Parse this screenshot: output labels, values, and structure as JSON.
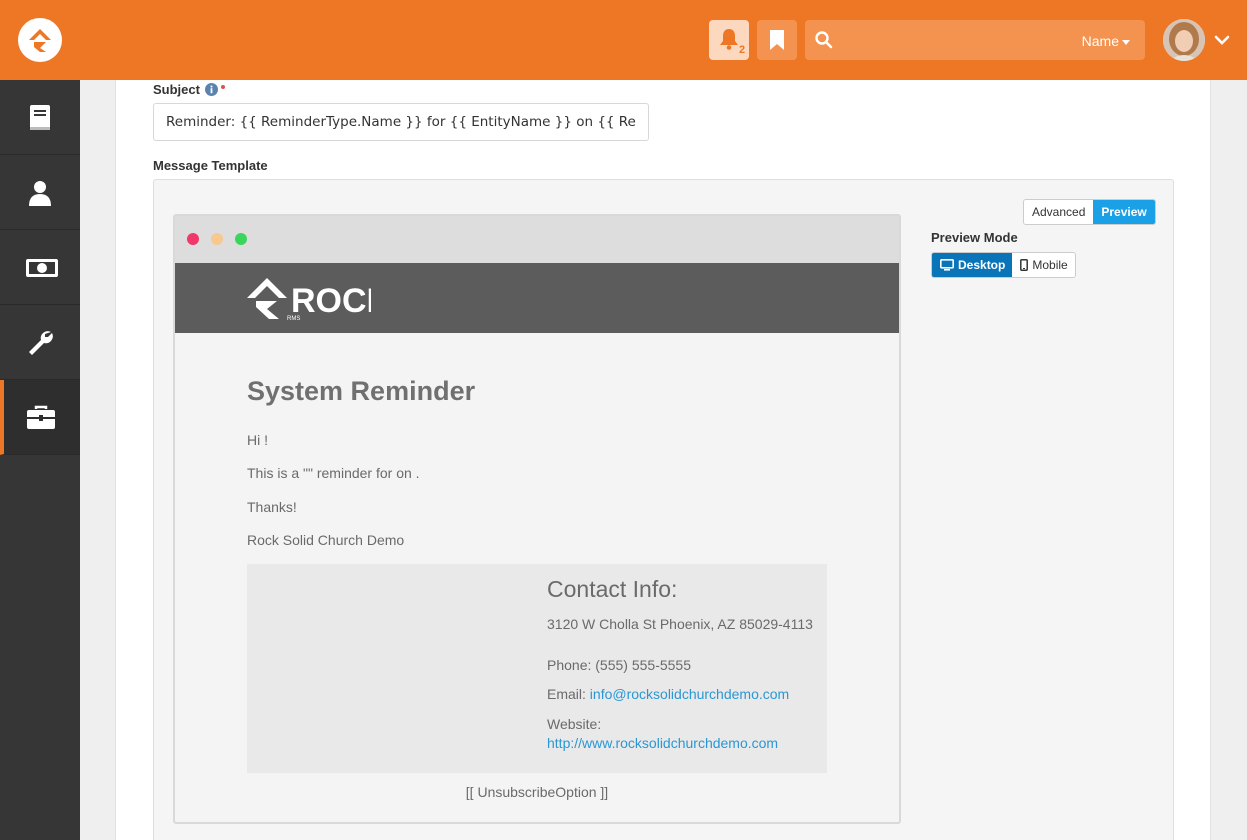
{
  "header": {
    "notification_count": "2",
    "search": {
      "placeholder": "",
      "filter_label": "Name"
    },
    "colors": {
      "accent": "#ee7725"
    }
  },
  "sidebar": {
    "items": [
      {
        "icon": "book-icon"
      },
      {
        "icon": "person-icon"
      },
      {
        "icon": "money-icon"
      },
      {
        "icon": "wrench-icon"
      },
      {
        "icon": "briefcase-icon",
        "active": true
      }
    ]
  },
  "form": {
    "subject_label": "Subject",
    "subject_value": "Reminder: {{ ReminderType.Name }} for {{ EntityName }} on {{ ReminderDate | Date:'dddd, MMMM d, yyyy' }}",
    "message_template_label": "Message Template",
    "view_toggle": {
      "advanced": "Advanced",
      "preview": "Preview",
      "selected": "Preview"
    },
    "preview_mode": {
      "label": "Preview Mode",
      "desktop": "Desktop",
      "mobile": "Mobile",
      "selected": "Desktop"
    }
  },
  "email": {
    "logo_text": "ROCK",
    "logo_subtext": "RMS",
    "title": "System Reminder",
    "greeting": "Hi !",
    "body": "This is a \"\" reminder for on .",
    "thanks": "Thanks!",
    "signature": "Rock Solid Church Demo",
    "contact": {
      "title": "Contact Info:",
      "address": "3120 W Cholla St Phoenix, AZ 85029-4113",
      "phone": "Phone: (555) 555-5555",
      "email_label": "Email:",
      "email": "info@rocksolidchurchdemo.com",
      "website_label": "Website:",
      "website": "http://www.rocksolidchurchdemo.com"
    },
    "unsubscribe": "[[ UnsubscribeOption ]]"
  }
}
